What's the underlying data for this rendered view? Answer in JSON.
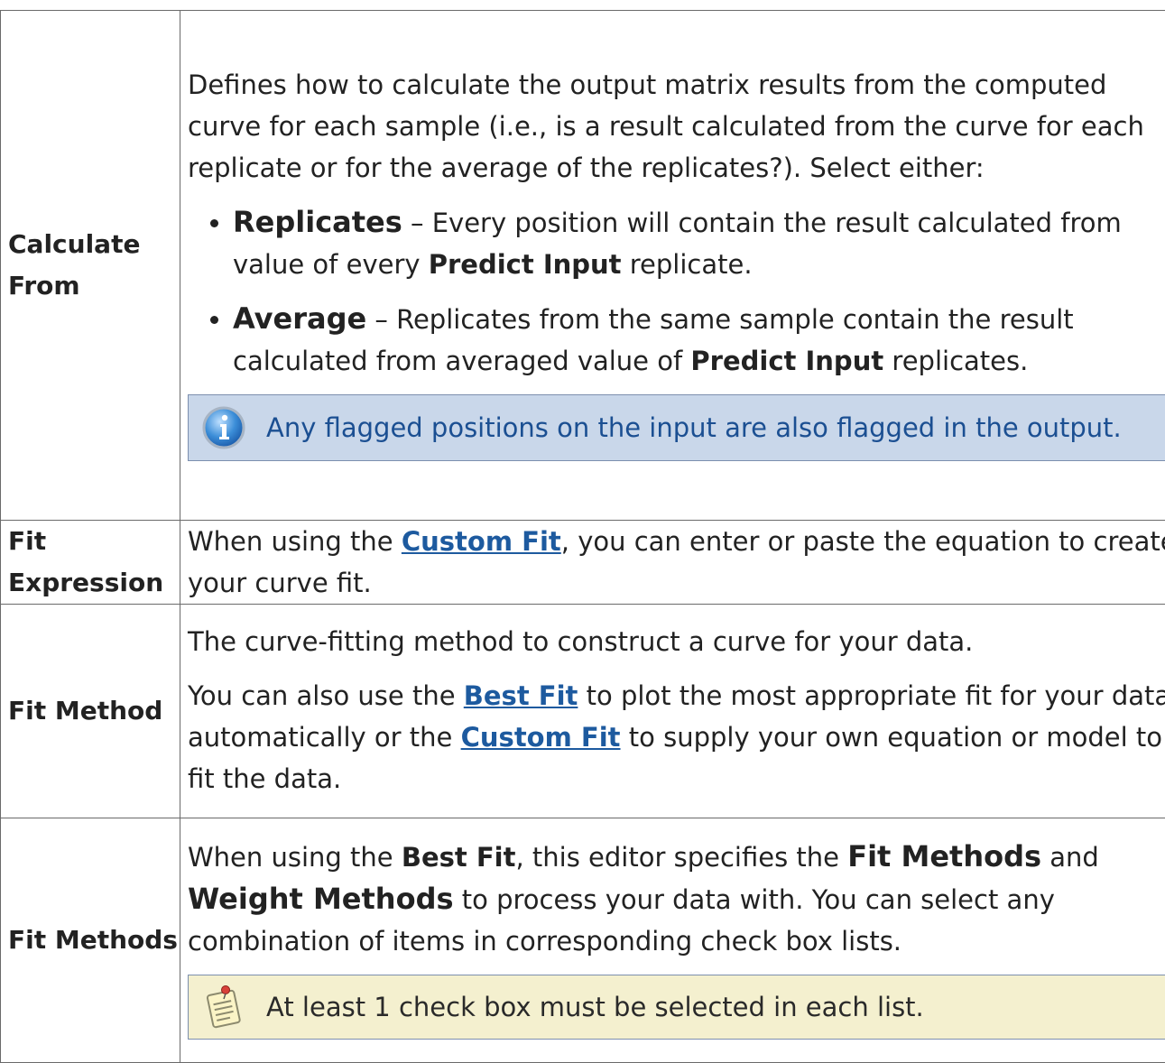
{
  "rows": {
    "calc_from": {
      "label": "Calculate From",
      "intro": "Defines how to calculate the output matrix results from the computed curve for each sample (i.e., is a result calculated from the curve for each replicate or for the average of the replicates?). Select either:",
      "options": [
        {
          "term": "Replicates",
          "text_a": " – Every position will contain the result calculated from value of every ",
          "bold": "Predict Input",
          "text_b": " replicate."
        },
        {
          "term": "Average",
          "text_a": " – Replicates from the same sample contain the result calculated from averaged value of ",
          "bold": "Predict Input",
          "text_b": " replicates."
        }
      ],
      "note": "Any flagged positions on the input are also flagged in the output.",
      "note_icon": "info-icon"
    },
    "fit_expression": {
      "label": "Fit Expression",
      "text_a": "When using the ",
      "link": "Custom Fit",
      "text_b": ", you can enter or paste the equation to create your curve fit."
    },
    "fit_method": {
      "label": "Fit Method",
      "p1": "The curve-fitting method to construct a curve for your data.",
      "p2_a": "You can also use the ",
      "p2_link1": "Best Fit",
      "p2_b": " to plot the most appropriate fit for your data automatically or the ",
      "p2_link2": "Custom Fit",
      "p2_c": " to supply your own equation or model to fit the data."
    },
    "fit_methods": {
      "label": "Fit Methods",
      "text_a": "When using the ",
      "b1": "Best Fit",
      "text_b": ", this editor specifies the ",
      "b2": "Fit Methods",
      "text_c": " and ",
      "b3": "Weight Methods",
      "text_d": " to process your data with. You can select any combination of items in corresponding check box lists.",
      "note": "At least 1 check box must be selected in each list.",
      "note_icon": "notepad-pin-icon"
    }
  },
  "colors": {
    "link": "#1d5a9f",
    "info_bg": "#c9d7ea",
    "tip_bg": "#f4f0cf"
  }
}
